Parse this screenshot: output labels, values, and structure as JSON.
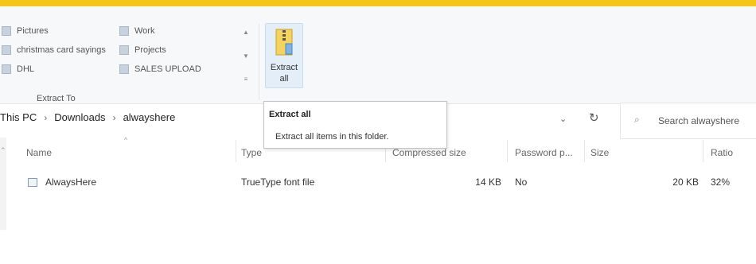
{
  "ribbon": {
    "destinations": [
      "Pictures",
      "christmas card sayings",
      "DHL",
      "Work",
      "Projects",
      "SALES UPLOAD"
    ],
    "group_label": "Extract To",
    "extract_all_label": "Extract all"
  },
  "tooltip": {
    "title": "Extract all",
    "text": "Extract all items in this folder."
  },
  "address": {
    "parts": [
      "This PC",
      "Downloads",
      "alwayshere"
    ]
  },
  "search": {
    "placeholder": "Search alwayshere"
  },
  "columns": [
    "Name",
    "Type",
    "Compressed size",
    "Password p...",
    "Size",
    "Ratio"
  ],
  "files": [
    {
      "name": "AlwaysHere",
      "type": "TrueType font file",
      "compressed_size": "14 KB",
      "password": "No",
      "size": "20 KB",
      "ratio": "32%"
    }
  ]
}
